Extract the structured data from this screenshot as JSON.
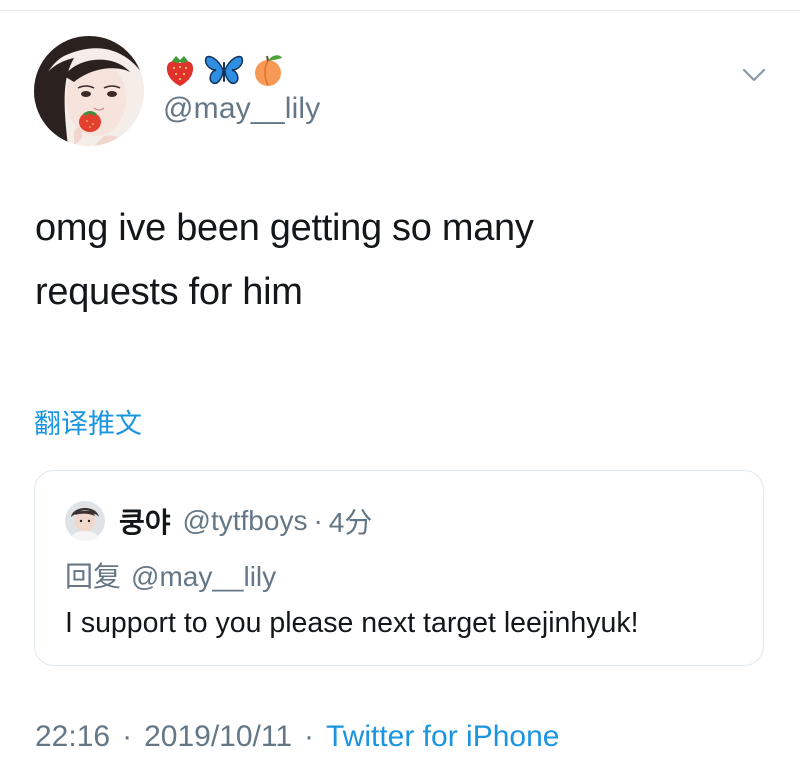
{
  "tweet": {
    "display_name_emojis": [
      "strawberry-icon",
      "butterfly-icon",
      "peach-icon"
    ],
    "handle": "@may__lily",
    "text_lines": [
      "omg ive been getting so many",
      "requests for him"
    ],
    "translate_label": "翻译推文"
  },
  "reply": {
    "name": "쿵야",
    "handle": "@tytfboys",
    "separator": "·",
    "time": "4分",
    "reply_prefix": "回复",
    "reply_to": "@may__lily",
    "text": "I support to you please next target leejinhyuk!"
  },
  "meta": {
    "time": "22:16",
    "date": "2019/10/11",
    "separator": "·",
    "source": "Twitter for iPhone"
  },
  "colors": {
    "link": "#1b95e0",
    "secondary_text": "#657786",
    "primary_text": "#14171a",
    "border": "#e1e8ed"
  }
}
